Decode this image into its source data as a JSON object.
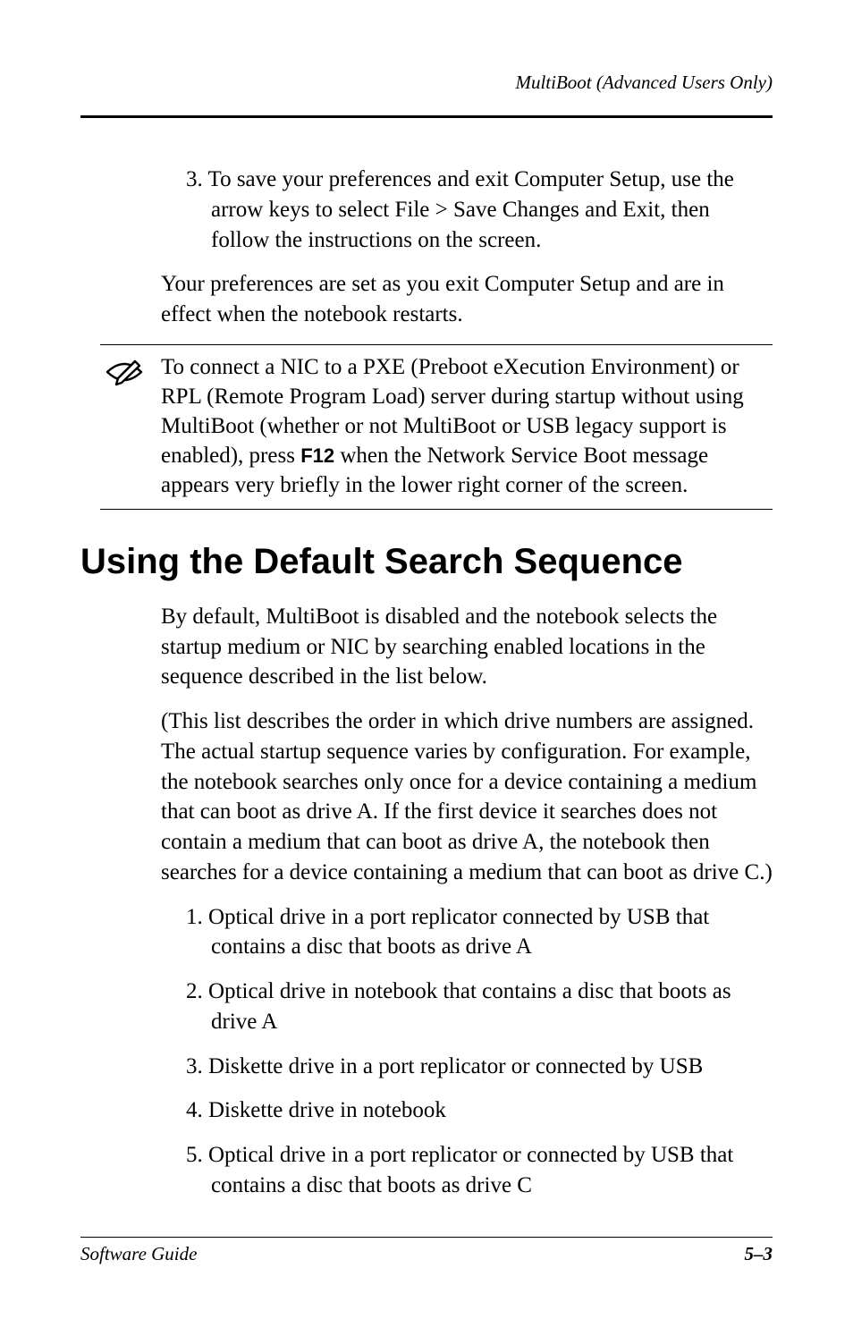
{
  "header": {
    "running_title": "MultiBoot (Advanced Users Only)"
  },
  "body": {
    "step3_num": "3.",
    "step3_text": " To save your preferences and exit Computer Setup, use the arrow keys to select File > Save Changes and Exit, then follow the instructions on the screen.",
    "para_after_steps": "Your preferences are set as you exit Computer Setup and are in effect when the notebook restarts.",
    "note_prefix": "To connect a NIC to a PXE (Preboot eXecution Environment) or RPL (Remote Program Load) server during startup without using MultiBoot (whether or not MultiBoot or USB legacy support is enabled), press ",
    "note_key": "F12",
    "note_suffix": " when the Network Service Boot message appears very briefly in the lower right corner of the screen.",
    "section_title": "Using the Default Search Sequence",
    "para_intro": "By default, MultiBoot is disabled and the notebook selects the startup medium or NIC by searching enabled locations in the sequence described in the list below.",
    "para_paren": "(This list describes the order in which drive numbers are assigned. The actual startup sequence varies by configuration. For example, the notebook searches only once for a device containing a medium that can boot as drive A. If the first device it searches does not contain a medium that can boot as drive A, the notebook then searches for a device containing a medium that can boot as drive C.)",
    "list": [
      {
        "num": "1.",
        "text": " Optical drive in a port replicator connected by USB that contains a disc that boots as drive A"
      },
      {
        "num": "2.",
        "text": " Optical drive in notebook that contains a disc that boots as drive A"
      },
      {
        "num": "3.",
        "text": " Diskette drive in a port replicator or connected by USB"
      },
      {
        "num": "4.",
        "text": " Diskette drive in notebook"
      },
      {
        "num": "5.",
        "text": " Optical drive in a port replicator or connected by USB that contains a disc that boots as drive C"
      }
    ]
  },
  "footer": {
    "left": "Software Guide",
    "right": "5–3"
  }
}
